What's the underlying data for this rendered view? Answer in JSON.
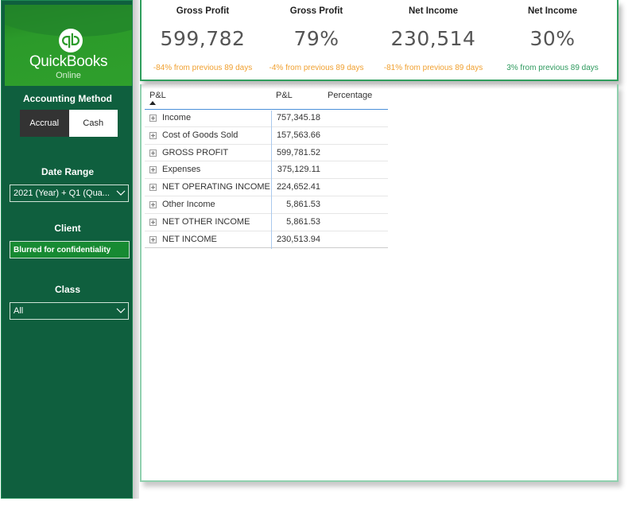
{
  "sidebar": {
    "logo": {
      "brand": "QuickBooks",
      "sub": "Online",
      "icon": "qb-logo-icon"
    },
    "accounting_method": {
      "label": "Accounting Method",
      "options": [
        "Accrual",
        "Cash"
      ],
      "selected": "Accrual"
    },
    "date_range": {
      "label": "Date Range",
      "value": "2021 (Year) + Q1 (Qua...",
      "icon": "chevron-down-icon"
    },
    "client": {
      "label": "Client",
      "value": "Blurred for confidentiality"
    },
    "class": {
      "label": "Class",
      "value": "All",
      "icon": "chevron-down-icon"
    }
  },
  "kpis": [
    {
      "title": "Gross Profit",
      "value": "599,782",
      "delta": "-84% from previous 89 days",
      "delta_color": "#f0a030"
    },
    {
      "title": "Gross Profit",
      "value": "79%",
      "delta": "-4% from previous 89 days",
      "delta_color": "#f0a030"
    },
    {
      "title": "Net Income",
      "value": "230,514",
      "delta": "-81% from previous 89 days",
      "delta_color": "#f0a030"
    },
    {
      "title": "Net Income",
      "value": "30%",
      "delta": "3% from previous 89 days",
      "delta_color": "#2e9a5e"
    }
  ],
  "table": {
    "headers": [
      "P&L",
      "P&L",
      "Percentage"
    ],
    "sort": "ascending",
    "rows": [
      {
        "label": "Income",
        "value": "757,345.18",
        "percentage": ""
      },
      {
        "label": "Cost of Goods Sold",
        "value": "157,563.66",
        "percentage": ""
      },
      {
        "label": "GROSS PROFIT",
        "value": "599,781.52",
        "percentage": ""
      },
      {
        "label": "Expenses",
        "value": "375,129.11",
        "percentage": ""
      },
      {
        "label": "NET OPERATING INCOME",
        "value": "224,652.41",
        "percentage": ""
      },
      {
        "label": "Other Income",
        "value": "5,861.53",
        "percentage": ""
      },
      {
        "label": "NET OTHER INCOME",
        "value": "5,861.53",
        "percentage": ""
      },
      {
        "label": "NET INCOME",
        "value": "230,513.94",
        "percentage": ""
      }
    ]
  },
  "colors": {
    "sidebar_bg": "#0f5f3e",
    "logo_green": "#2b9a2a",
    "card_border": "#2f9e5d",
    "negative_delta": "#f0a030",
    "positive_delta": "#2e9a5e",
    "header_rule": "#4a90d9"
  }
}
